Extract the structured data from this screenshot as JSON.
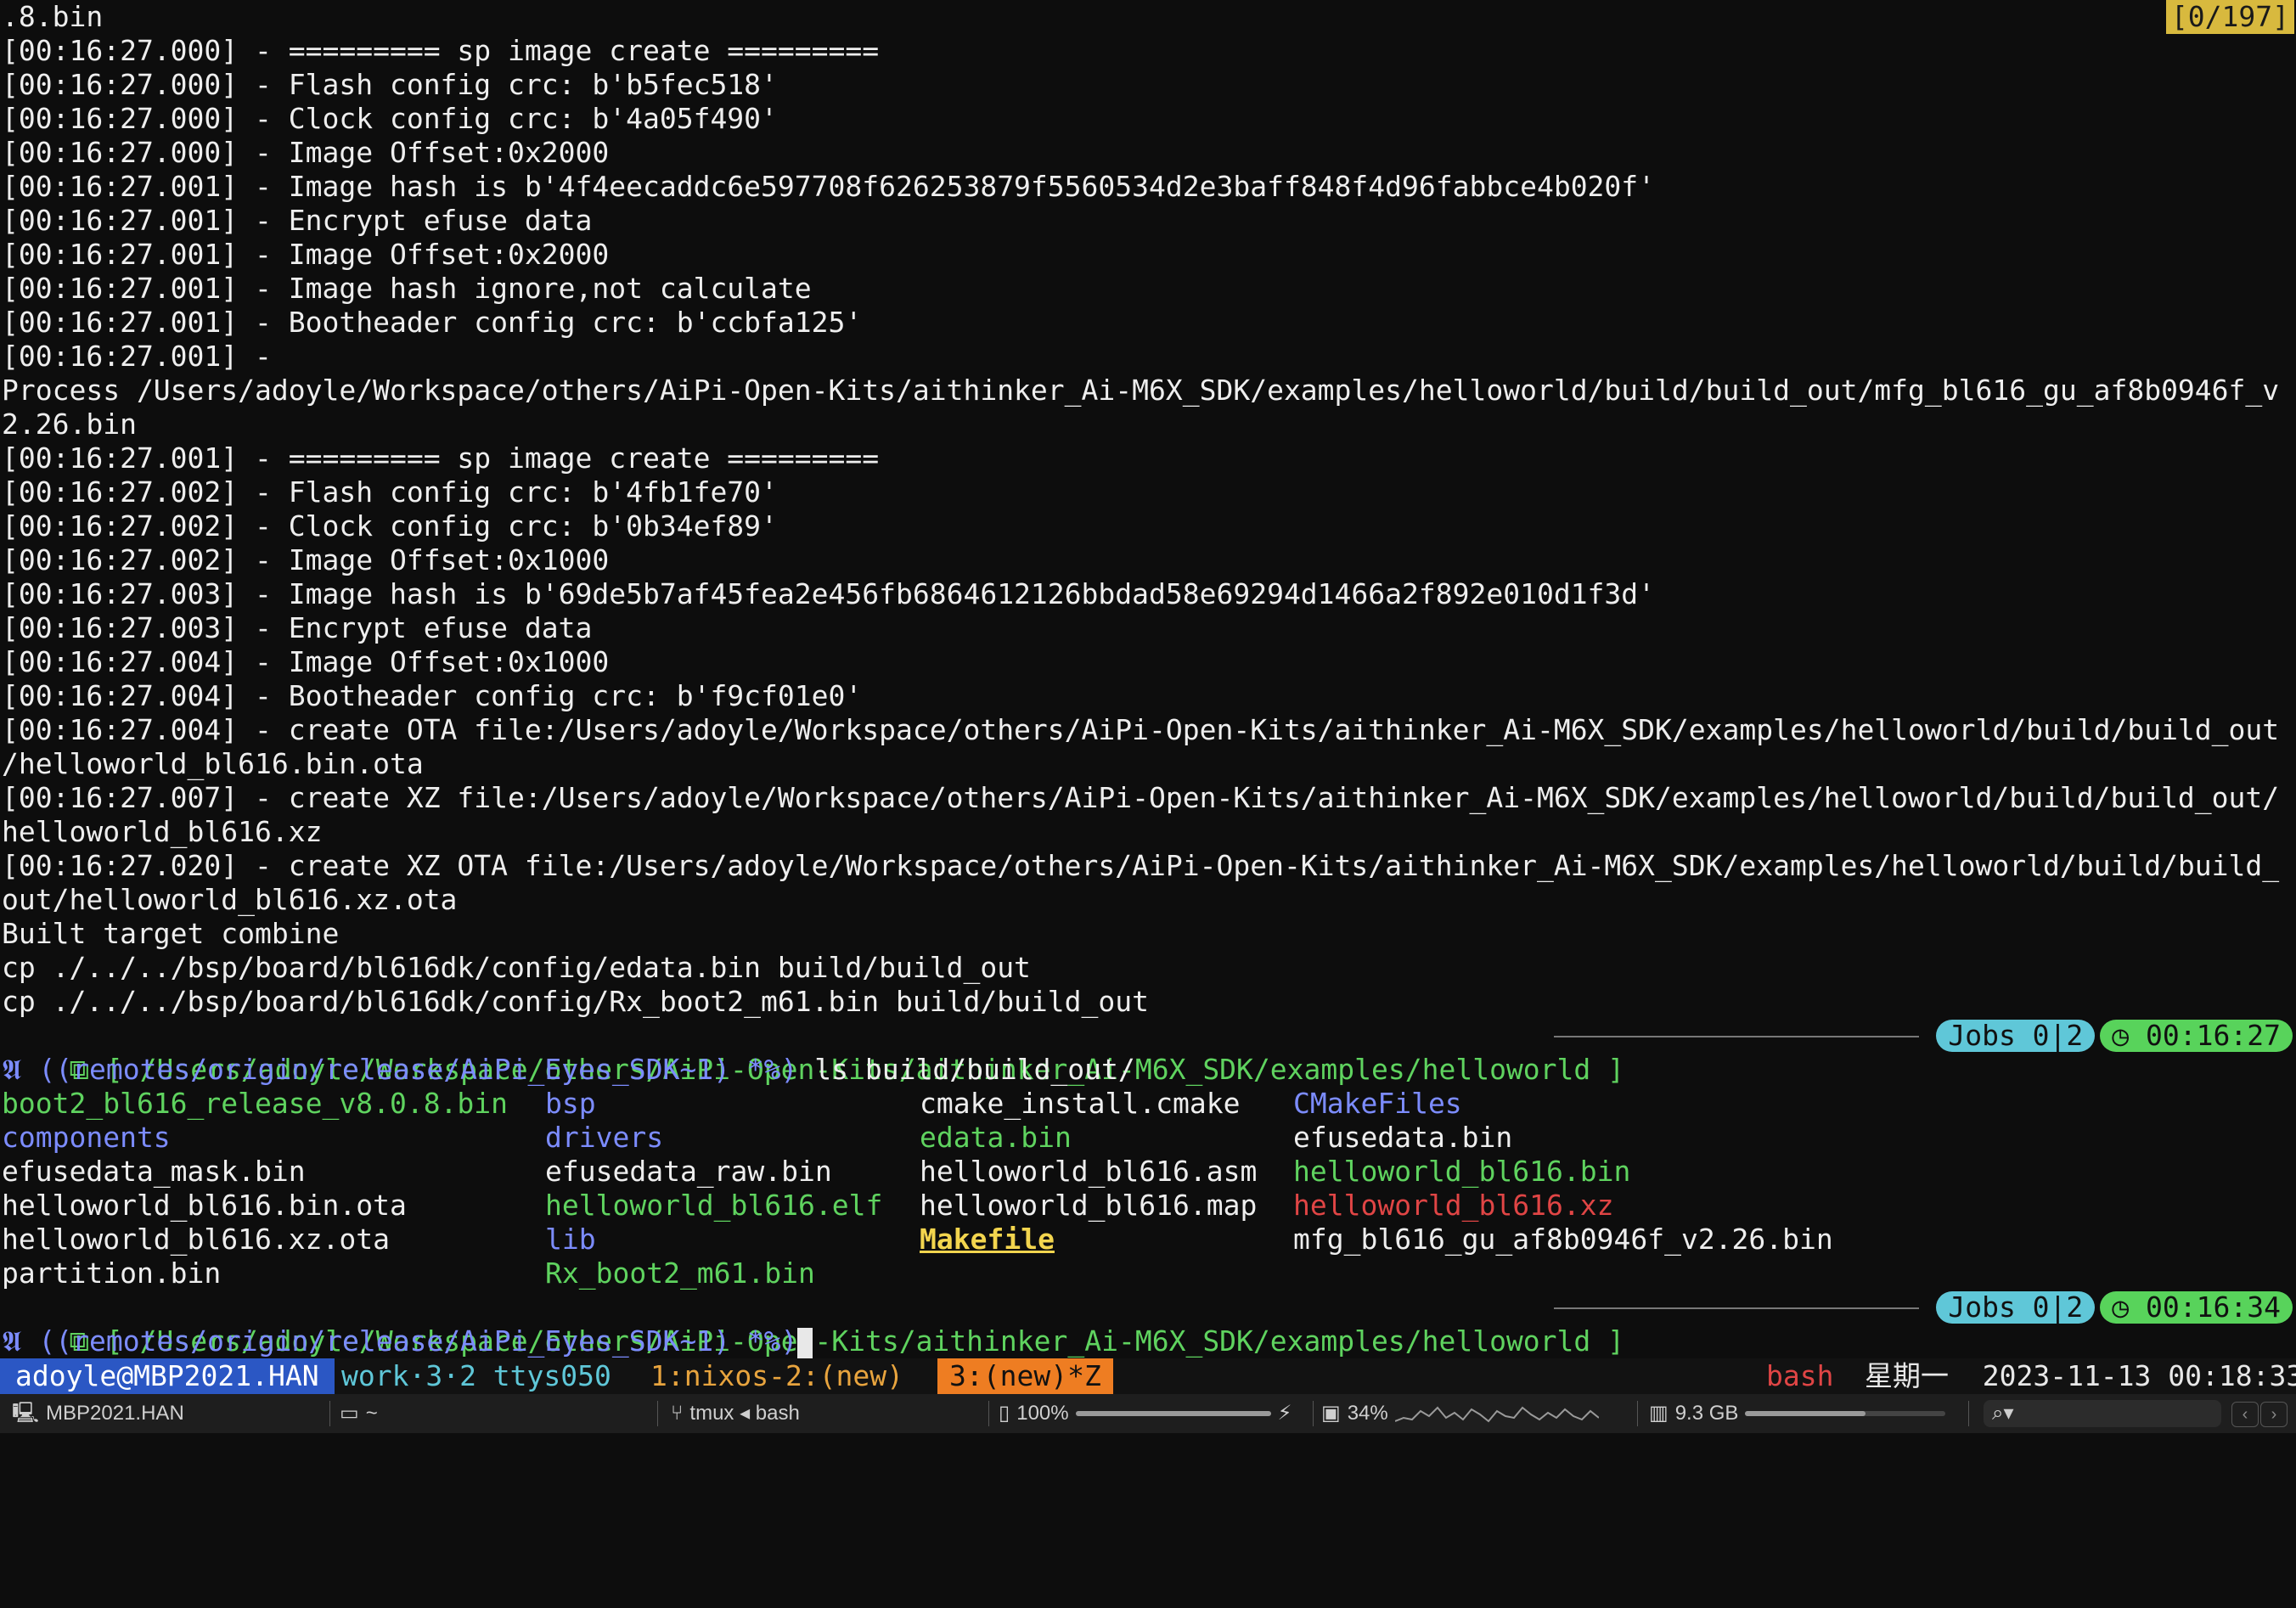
{
  "counter": "[0/197]",
  "log_lines": [
    ".8.bin",
    "[00:16:27.000] - ========= sp image create =========",
    "[00:16:27.000] - Flash config crc: b'b5fec518'",
    "[00:16:27.000] - Clock config crc: b'4a05f490'",
    "[00:16:27.000] - Image Offset:0x2000",
    "[00:16:27.001] - Image hash is b'4f4eecaddc6e597708f626253879f5560534d2e3baff848f4d96fabbce4b020f'",
    "[00:16:27.001] - Encrypt efuse data",
    "[00:16:27.001] - Image Offset:0x2000",
    "[00:16:27.001] - Image hash ignore,not calculate",
    "[00:16:27.001] - Bootheader config crc: b'ccbfa125'",
    "[00:16:27.001] -",
    "Process /Users/adoyle/Workspace/others/AiPi-Open-Kits/aithinker_Ai-M6X_SDK/examples/helloworld/build/build_out/mfg_bl616_gu_af8b0946f_v",
    "2.26.bin",
    "[00:16:27.001] - ========= sp image create =========",
    "[00:16:27.002] - Flash config crc: b'4fb1fe70'",
    "[00:16:27.002] - Clock config crc: b'0b34ef89'",
    "[00:16:27.002] - Image Offset:0x1000",
    "[00:16:27.003] - Image hash is b'69de5b7af45fea2e456fb6864612126bbdad58e69294d1466a2f892e010d1f3d'",
    "[00:16:27.003] - Encrypt efuse data",
    "[00:16:27.004] - Image Offset:0x1000",
    "[00:16:27.004] - Bootheader config crc: b'f9cf01e0'",
    "[00:16:27.004] - create OTA file:/Users/adoyle/Workspace/others/AiPi-Open-Kits/aithinker_Ai-M6X_SDK/examples/helloworld/build/build_out",
    "/helloworld_bl616.bin.ota",
    "[00:16:27.007] - create XZ file:/Users/adoyle/Workspace/others/AiPi-Open-Kits/aithinker_Ai-M6X_SDK/examples/helloworld/build/build_out/",
    "helloworld_bl616.xz",
    "[00:16:27.020] - create XZ OTA file:/Users/adoyle/Workspace/others/AiPi-Open-Kits/aithinker_Ai-M6X_SDK/examples/helloworld/build/build_",
    "out/helloworld_bl616.xz.ota",
    "Built target combine",
    "cp ./../../bsp/board/bl616dk/config/edata.bin build/build_out",
    "cp ./../../bsp/board/bl616dk/config/Rx_boot2_m61.bin build/build_out"
  ],
  "prompt1": {
    "path": "⧉ [ /Users/adoyle/Workspace/others/AiPi-Open-Kits/aithinker_Ai-M6X_SDK/examples/helloworld ]",
    "jobs": "Jobs 0|2",
    "time": "00:16:27",
    "git": "𝕬 ((remotes/origin/release/AiPi_Eyes_SDK~1) *%)",
    "command": " ls build/build_out/"
  },
  "ls_output": [
    [
      {
        "name": "boot2_bl616_release_v8.0.8.bin",
        "color": "green"
      },
      {
        "name": "bsp",
        "color": "blue"
      },
      {
        "name": "cmake_install.cmake",
        "color": "white"
      },
      {
        "name": "CMakeFiles",
        "color": "blue"
      }
    ],
    [
      {
        "name": "components",
        "color": "blue"
      },
      {
        "name": "drivers",
        "color": "blue"
      },
      {
        "name": "edata.bin",
        "color": "green"
      },
      {
        "name": "efusedata.bin",
        "color": "white"
      }
    ],
    [
      {
        "name": "efusedata_mask.bin",
        "color": "white"
      },
      {
        "name": "efusedata_raw.bin",
        "color": "white"
      },
      {
        "name": "helloworld_bl616.asm",
        "color": "white"
      },
      {
        "name": "helloworld_bl616.bin",
        "color": "green"
      }
    ],
    [
      {
        "name": "helloworld_bl616.bin.ota",
        "color": "white"
      },
      {
        "name": "helloworld_bl616.elf",
        "color": "green"
      },
      {
        "name": "helloworld_bl616.map",
        "color": "white"
      },
      {
        "name": "helloworld_bl616.xz",
        "color": "red"
      }
    ],
    [
      {
        "name": "helloworld_bl616.xz.ota",
        "color": "white"
      },
      {
        "name": "lib",
        "color": "blue"
      },
      {
        "name": "Makefile",
        "color": "yel"
      },
      {
        "name": "mfg_bl616_gu_af8b0946f_v2.26.bin",
        "color": "white"
      }
    ],
    [
      {
        "name": "partition.bin",
        "color": "white"
      },
      {
        "name": "Rx_boot2_m61.bin",
        "color": "green"
      },
      {
        "name": "",
        "color": "white"
      },
      {
        "name": "",
        "color": "white"
      }
    ]
  ],
  "prompt2": {
    "path": "⧉ [ /Users/adoyle/Workspace/others/AiPi-Open-Kits/aithinker_Ai-M6X_SDK/examples/helloworld ]",
    "jobs": "Jobs 0|2",
    "time": "00:16:34",
    "git": "𝕬 ((remotes/origin/release/AiPi_Eyes_SDK~1) *%)"
  },
  "tmux": {
    "session": "adoyle@MBP2021.HAN",
    "work": "work·3·2 ttys050",
    "window1": "1:nixos-2:(new)",
    "window3": "3:(new)*Z",
    "shell": "bash",
    "date": "星期一  2023-11-13 00:18:33"
  },
  "bottombar": {
    "host": "MBP2021.HAN",
    "dir": "~",
    "process": "tmux ◂ bash",
    "battery": "100%",
    "battery_fraction": 1.0,
    "cpu": "34%",
    "memory": "9.3 GB",
    "memory_fraction": 0.6,
    "search_icon": "search-icon"
  }
}
